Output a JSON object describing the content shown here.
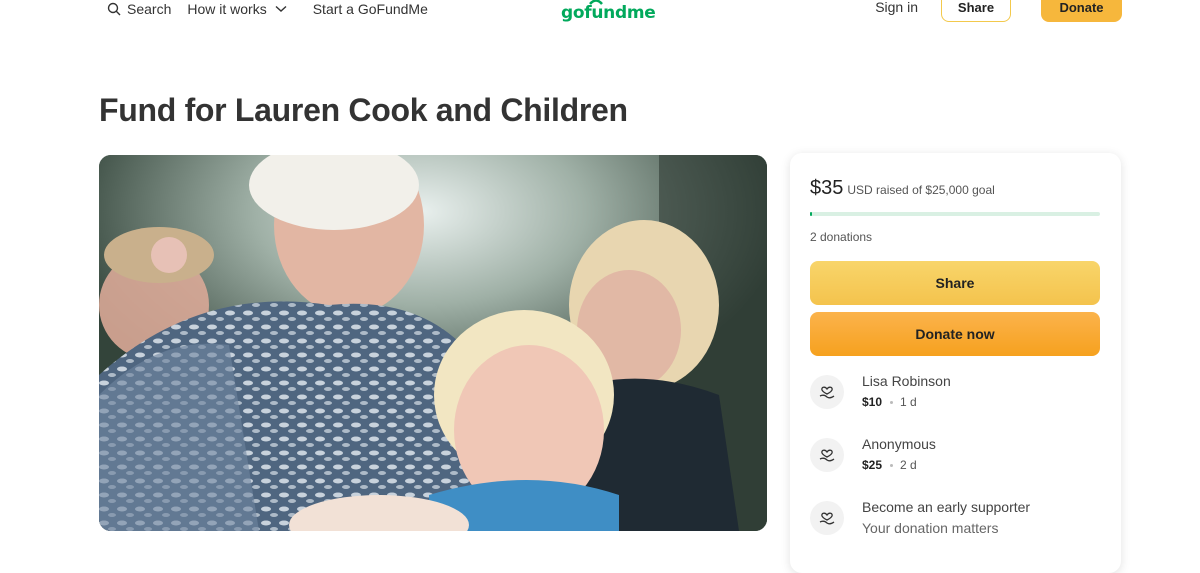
{
  "header": {
    "search_label": "Search",
    "how_it_works_label": "How it works",
    "start_label": "Start a GoFundMe",
    "logo_text": "gofundme",
    "signin_label": "Sign in",
    "share_label": "Share",
    "donate_label": "Donate"
  },
  "campaign": {
    "title": "Fund for Lauren Cook and Children"
  },
  "sidebar": {
    "raised_amount": "$35",
    "raised_rest": "USD raised of $25,000 goal",
    "progress_fraction": 0.0014,
    "donations_count": "2 donations",
    "share_button": "Share",
    "donate_button": "Donate now",
    "donors": [
      {
        "name": "Lisa Robinson",
        "amount": "$10",
        "time": "1 d"
      },
      {
        "name": "Anonymous",
        "amount": "$25",
        "time": "2 d"
      }
    ],
    "early_supporter": {
      "title": "Become an early supporter",
      "subtitle": "Your donation matters"
    }
  },
  "colors": {
    "brand_green": "#02a95c",
    "accent_yellow": "#f6b73c",
    "accent_orange": "#f6a11e"
  }
}
